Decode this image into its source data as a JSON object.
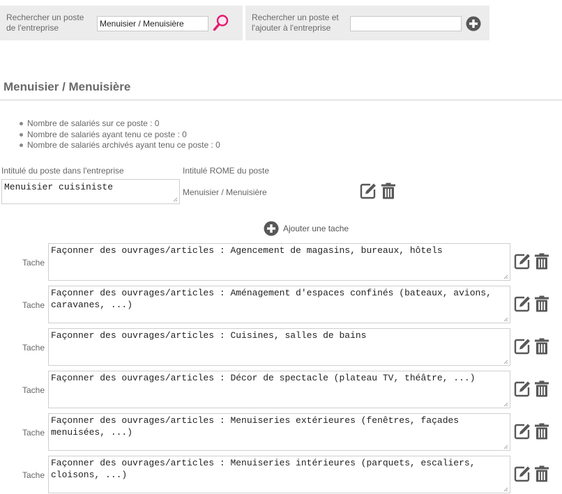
{
  "search_existing": {
    "label": "Rechercher un poste de l'entreprise",
    "value": "Menuisier / Menuisière"
  },
  "search_add": {
    "label": "Rechercher un poste et l'ajouter à l'entreprise",
    "value": ""
  },
  "page_title": "Menuisier / Menuisière",
  "stats": [
    "Nombre de salariés sur ce poste : 0",
    "Nombre de salariés ayant tenu ce poste : 0",
    "Nombre de salariés archivés ayant tenu ce poste : 0"
  ],
  "poste": {
    "intitule_label": "Intitulé du poste dans l'entreprise",
    "intitule_value": "Menuisier cuisiniste",
    "rome_label": "Intitulé ROME du poste",
    "rome_value": "Menuisier / Menuisière"
  },
  "add_task_label": "Ajouter une tache",
  "tasks": [
    {
      "label": "Tache",
      "text": "Façonner des ouvrages/articles : Agencement de magasins, bureaux, hôtels"
    },
    {
      "label": "Tache",
      "text": "Façonner des ouvrages/articles : Aménagement d'espaces confinés (bateaux, avions, caravanes, ...)"
    },
    {
      "label": "Tache",
      "text": "Façonner des ouvrages/articles : Cuisines, salles de bains"
    },
    {
      "label": "Tache",
      "text": "Façonner des ouvrages/articles : Décor de spectacle (plateau TV, théâtre, ...)"
    },
    {
      "label": "Tache",
      "text": "Façonner des ouvrages/articles : Menuiseries extérieures (fenêtres, façades menuisées, ...)"
    },
    {
      "label": "Tache",
      "text": "Façonner des ouvrages/articles : Menuiseries intérieures (parquets, escaliers, cloisons, ...)"
    }
  ],
  "icons": {
    "search": "magnifier-icon",
    "add": "plus-circle-icon",
    "edit": "edit-icon",
    "delete": "trash-icon"
  },
  "colors": {
    "panel_bg": "#ececec",
    "search_accent": "#e6186f",
    "icon_dark": "#585858"
  }
}
